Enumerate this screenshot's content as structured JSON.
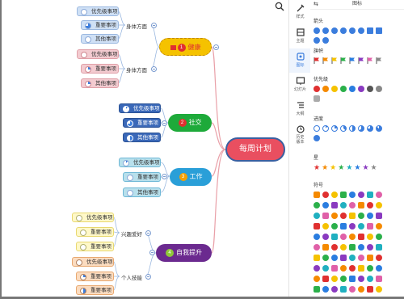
{
  "canvas": {
    "root": "每周计划",
    "topics": [
      {
        "num": "1",
        "label": "健康",
        "color": "#f5c200",
        "text": "#e03030"
      },
      {
        "num": "2",
        "label": "社交",
        "color": "#1eaa3a"
      },
      {
        "num": "3",
        "label": "工作",
        "color": "#2a9fd8"
      },
      {
        "num": "4",
        "label": "自我提升",
        "color": "#6b2a8f"
      }
    ],
    "groups": [
      "身体方面",
      "身体方面",
      "兴趣爱好",
      "个人技能"
    ],
    "leaves": {
      "a": [
        "优先级事项",
        "重要事项",
        "其他事项"
      ],
      "b": [
        "优先级事项",
        "重要事项",
        "其他事项"
      ],
      "c": [
        "优先级事项",
        "重要事项",
        "其他事项"
      ],
      "d": [
        "优先级事项",
        "重要事项",
        "其他事项"
      ],
      "e": [
        "优先级事项",
        "重要事项",
        "重要事项"
      ],
      "f": [
        "优先级事项",
        "重要事项",
        "重要事项"
      ]
    }
  },
  "toolbar": {
    "items": [
      "样式",
      "主题",
      "图标",
      "幻灯片",
      "大纲",
      "历史\n版本"
    ]
  },
  "panel": {
    "title": "图标",
    "sections": [
      "箭头",
      "旗帜",
      "优先级",
      "进度",
      "星",
      "符号"
    ]
  },
  "colors": {
    "blue": "#3b7ddd",
    "root": "#e94f60"
  }
}
